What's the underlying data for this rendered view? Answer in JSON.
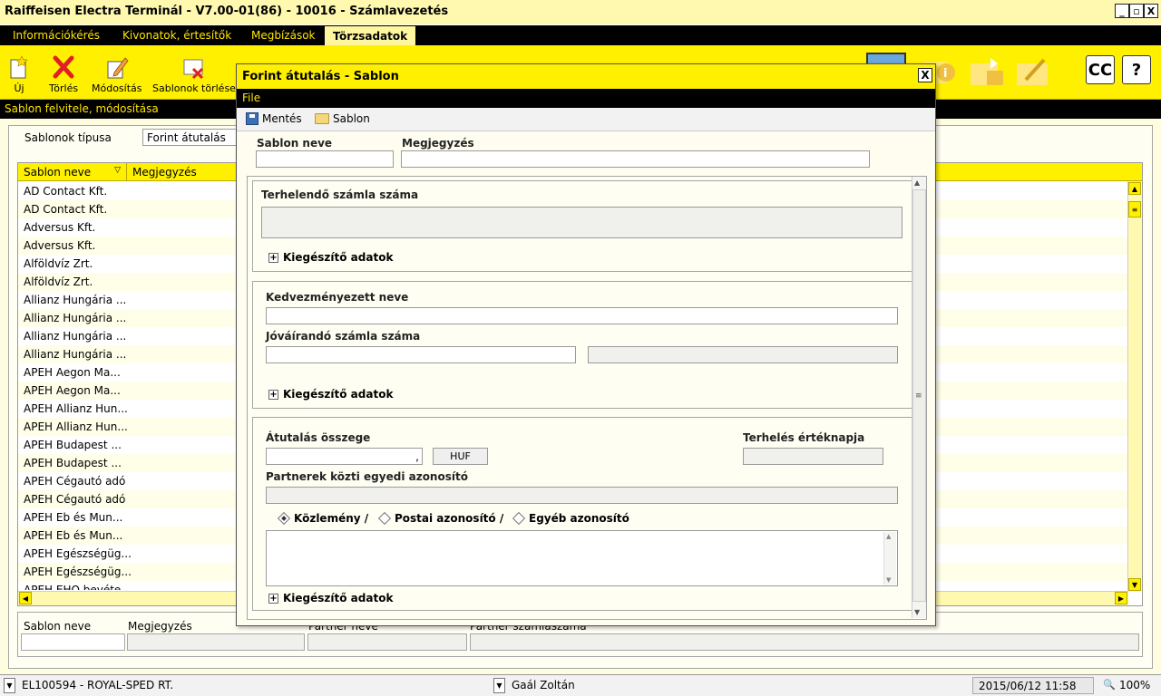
{
  "window": {
    "title": "Raiffeisen Electra Terminál - V7.00-01(86) - 10016 - Számlavezetés",
    "minimize": "_",
    "restore": "▫",
    "close": "X"
  },
  "menubar": {
    "items": [
      "Információkérés",
      "Kivonatok, értesítők",
      "Megbízások",
      "Törzsadatok"
    ],
    "active": "Törzsadatok"
  },
  "toolbar": {
    "new_label": "Új",
    "delete_label": "Törlés",
    "modify_label": "Módosítás",
    "delete_templates_label": "Sablonok törlése",
    "switch_label": "CC",
    "help_label": "?"
  },
  "section": {
    "title": "Sablon felvitele, módosítása"
  },
  "main": {
    "type_label": "Sablonok típusa",
    "type_value": "Forint átutalás",
    "columns": [
      "Sablon neve",
      "Megjegyzés"
    ],
    "rows": [
      "AD Contact Kft.",
      "AD Contact Kft.",
      "Adversus Kft.",
      "Adversus Kft.",
      "Alföldvíz Zrt.",
      "Alföldvíz Zrt.",
      "Allianz Hungária ...",
      "Allianz Hungária ...",
      "Allianz Hungária ...",
      "Allianz Hungária ...",
      "APEH Aegon Ma...",
      "APEH Aegon Ma...",
      "APEH Allianz Hun...",
      "APEH Allianz Hun...",
      "APEH Budapest ...",
      "APEH Budapest ...",
      "APEH Cégautó adó",
      "APEH Cégautó adó",
      "APEH Eb és Mun...",
      "APEH Eb és Mun...",
      "APEH Egészségüg...",
      "APEH Egészségüg...",
      "APEH EHO bevéte..."
    ],
    "filter": {
      "name_label": "Sablon neve",
      "note_label": "Megjegyzés",
      "partner_label": "Partner neve",
      "account_label": "Partner számlaszáma"
    }
  },
  "statusbar": {
    "account": "EL100594 - ROYAL-SPED RT.",
    "user": "Gaál Zoltán",
    "datetime": "2015/06/12 11:58",
    "zoom": "100%"
  },
  "dialog": {
    "title": "Forint átutalás - Sablon",
    "close": "X",
    "menu_file": "File",
    "save_label": "Mentés",
    "template_label": "Sablon",
    "template_name_label": "Sablon neve",
    "note_label": "Megjegyzés",
    "debit_account_label": "Terhelendő számla száma",
    "extra_data_label": "Kiegészítő adatok",
    "beneficiary_name_label": "Kedvezményezett neve",
    "credit_account_label": "Jóváírandó számla száma",
    "amount_label": "Átutalás összege",
    "amount_separator": ",",
    "currency": "HUF",
    "value_date_label": "Terhelés értéknapja",
    "partner_id_label": "Partnerek közti egyedi azonosító",
    "radio_options": [
      "Közlemény /",
      "Postai azonosító /",
      "Egyéb azonosító"
    ],
    "radio_selected": "Közlemény /"
  }
}
